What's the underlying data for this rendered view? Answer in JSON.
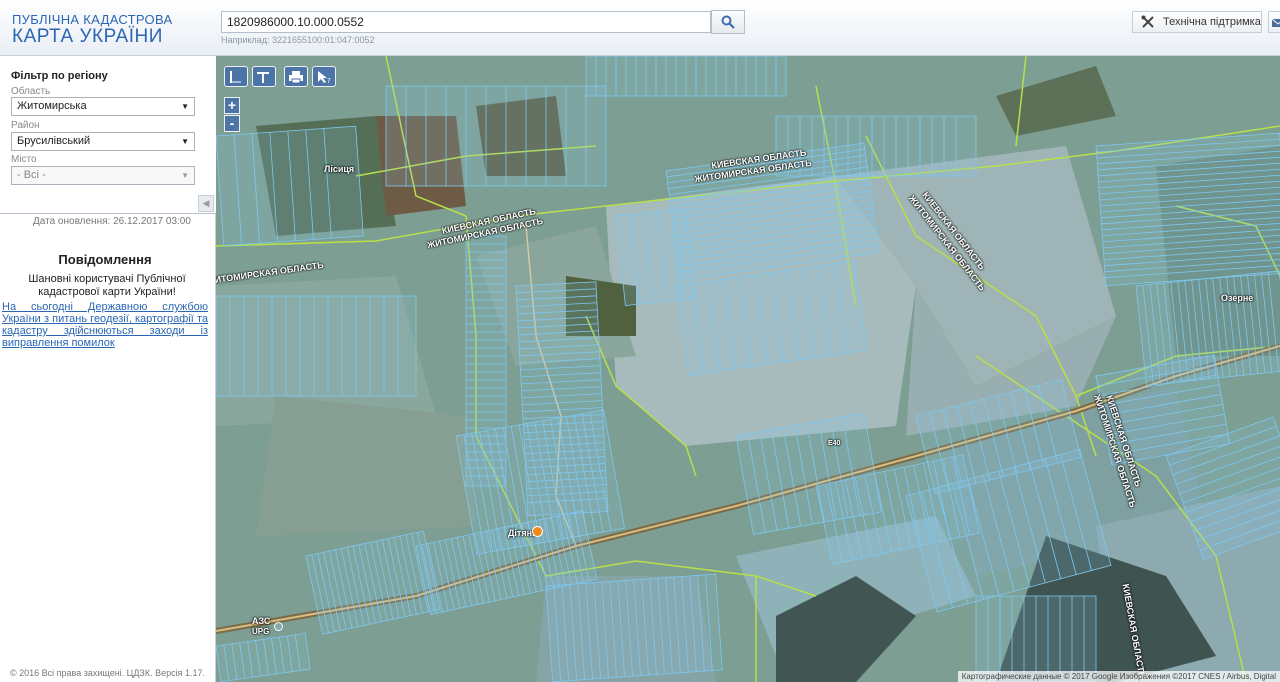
{
  "header": {
    "logo_line1": "ПУБЛІЧНА КАДАСТРОВА",
    "logo_line2": "КАРТА УКРАЇНИ",
    "search_value": "1820986000.10.000.0552",
    "search_hint": "Наприклад: 3221655100:01:047:0052",
    "support_label": "Технічна підтримка",
    "search_icon": "search-icon",
    "support_icon": "tools-icon",
    "mail_icon": "mail-icon"
  },
  "filter": {
    "title": "Фільтр по регіону",
    "oblast_label": "Область",
    "oblast_value": "Житомирська",
    "rayon_label": "Район",
    "rayon_value": "Брусилівський",
    "misto_label": "Місто",
    "misto_value": "- Всі -"
  },
  "sidebar": {
    "update_date": "Дата оновлення: 26.12.2017 03:00",
    "notice_title": "Повідомлення",
    "notice_greeting": "Шановні користувачі Публічної кадастрової карти України!",
    "notice_link": "На сьогодні Державною службою України з питань геодезії, картографії та кадастру здійснюються заходи із виправлення помилок",
    "copyright": "© 2016 Всі права захищені. ЦДЗК. Версія 1.17."
  },
  "map": {
    "tools": [
      "ruler-icon",
      "area-ruler-icon",
      "print-icon",
      "identify-icon"
    ],
    "zoom_in": "+",
    "zoom_out": "-",
    "attribution": "Картографические данные © 2017 Google Изображения ©2017 CNES / Airbus, Digital",
    "labels": [
      {
        "text": "КИЕВСКАЯ ОБЛАСТЬ"
      },
      {
        "text": "ЖИТОМИРСКАЯ ОБЛАСТЬ"
      },
      {
        "text": "Лісиця"
      },
      {
        "text": "E40"
      },
      {
        "text": "Озерне"
      },
      {
        "text": "Дітяни"
      },
      {
        "text": "АЗС"
      },
      {
        "text": "UPG"
      }
    ],
    "colors": {
      "parcel": "#7ec8f0",
      "boundary": "#b7e04a",
      "road": "#e0c080"
    }
  }
}
